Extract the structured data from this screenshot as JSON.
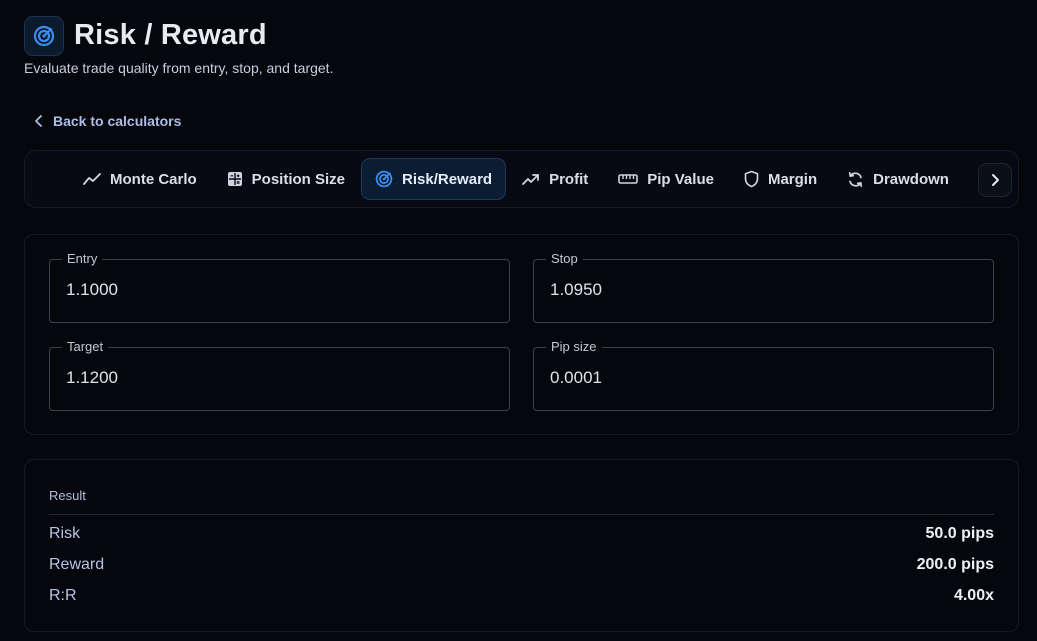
{
  "header": {
    "title": "Risk / Reward",
    "subtitle": "Evaluate trade quality from entry, stop, and target.",
    "icon": "target-icon"
  },
  "nav": {
    "back_label": "Back to calculators"
  },
  "tabs": [
    {
      "label": "Monte Carlo",
      "icon": "trend-line-icon",
      "active": false
    },
    {
      "label": "Position Size",
      "icon": "calculator-icon",
      "active": false
    },
    {
      "label": "Risk/Reward",
      "icon": "target-icon",
      "active": true
    },
    {
      "label": "Profit",
      "icon": "trend-up-icon",
      "active": false
    },
    {
      "label": "Pip Value",
      "icon": "ruler-icon",
      "active": false
    },
    {
      "label": "Margin",
      "icon": "shield-icon",
      "active": false
    },
    {
      "label": "Drawdown",
      "icon": "refresh-icon",
      "active": false
    }
  ],
  "inputs": {
    "entry": {
      "label": "Entry",
      "value": "1.1000"
    },
    "stop": {
      "label": "Stop",
      "value": "1.0950"
    },
    "target": {
      "label": "Target",
      "value": "1.1200"
    },
    "pip_size": {
      "label": "Pip size",
      "value": "0.0001"
    }
  },
  "result": {
    "title": "Result",
    "rows": [
      {
        "label": "Risk",
        "value": "50.0 pips"
      },
      {
        "label": "Reward",
        "value": "200.0 pips"
      },
      {
        "label": "R:R",
        "value": "4.00x"
      }
    ]
  },
  "colors": {
    "background": "#05070d",
    "accent": "#3b8cf0",
    "active_tab_bg": "#0b1d32"
  }
}
